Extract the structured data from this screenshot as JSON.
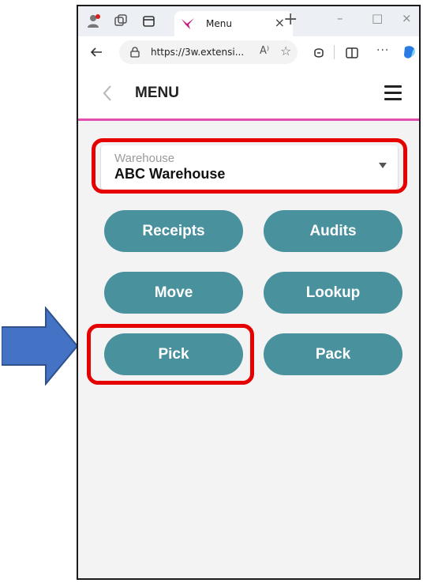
{
  "colors": {
    "accent_pink": "#e34fb0",
    "button_teal": "#4a919e",
    "highlight_red": "#e60000",
    "arrow_blue": "#4472c4"
  },
  "browser": {
    "tab": {
      "title": "Menu",
      "icon": "app-logo-icon"
    },
    "address": {
      "url": "https://3w.extensi..."
    }
  },
  "app": {
    "header": {
      "title": "MENU",
      "back_icon": "chevron-left-icon",
      "menu_icon": "hamburger-icon"
    },
    "warehouse": {
      "label": "Warehouse",
      "value": "ABC Warehouse"
    },
    "buttons": [
      {
        "label": "Receipts"
      },
      {
        "label": "Audits"
      },
      {
        "label": "Move"
      },
      {
        "label": "Lookup"
      },
      {
        "label": "Pick"
      },
      {
        "label": "Pack"
      }
    ]
  },
  "annotations": {
    "highlighted": [
      "warehouse-select",
      "pick-button"
    ],
    "arrow_points_to": "pick-button"
  }
}
